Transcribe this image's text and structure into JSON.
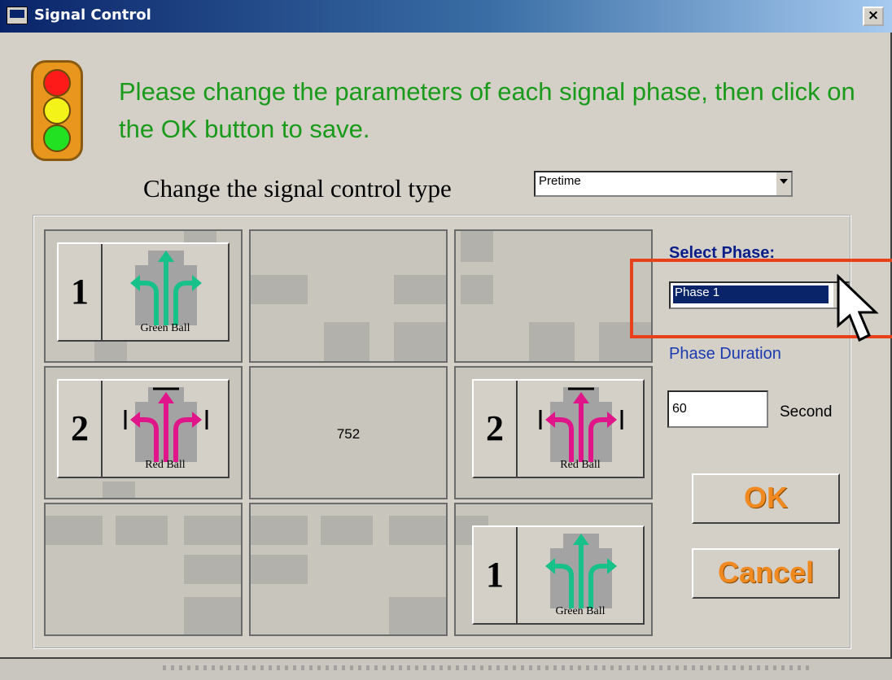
{
  "window": {
    "title": "Signal Control",
    "close_label": "×"
  },
  "instruction": "Please change the parameters of each signal phase, then click on the OK button to save.",
  "control_type": {
    "label": "Change the signal control type",
    "value": "Pretime"
  },
  "grid": {
    "center_label": "752",
    "buttons": [
      {
        "number": "1",
        "caption": "Green Ball",
        "color": "#18c08a"
      },
      {
        "number": "2",
        "caption": "Red Ball",
        "color": "#e0158a"
      },
      {
        "number": "2",
        "caption": "Red Ball",
        "color": "#e0158a"
      },
      {
        "number": "1",
        "caption": "Green Ball",
        "color": "#18c08a"
      }
    ]
  },
  "side": {
    "select_phase_label": "Select Phase:",
    "phase_value": "Phase 1",
    "duration_label": "Phase Duration",
    "duration_value": "60",
    "unit_label": "Second",
    "ok_label": "OK",
    "cancel_label": "Cancel"
  },
  "colors": {
    "instruction_text": "#1a9a1a",
    "highlight": "#e8401a",
    "action_text": "#f08a20"
  }
}
